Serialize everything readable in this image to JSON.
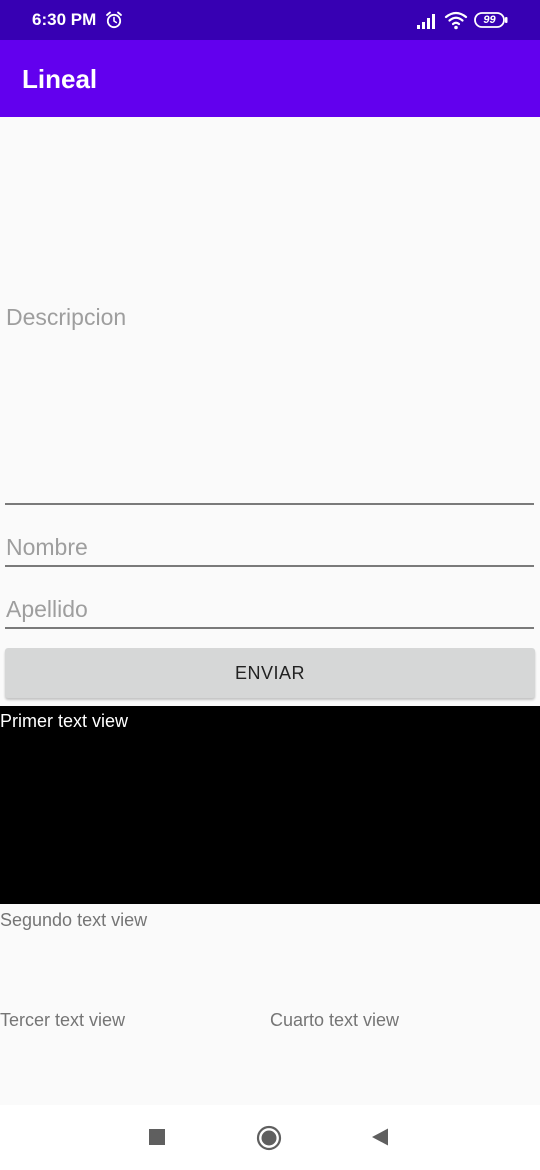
{
  "status_bar": {
    "time": "6:30 PM",
    "battery_level": "99",
    "icons": [
      "alarm-icon",
      "signal-icon",
      "wifi-icon",
      "battery-icon"
    ]
  },
  "app_bar": {
    "title": "Lineal"
  },
  "form": {
    "descripcion_hint": "Descripcion",
    "nombre_hint": "Nombre",
    "apellido_hint": "Apellido",
    "send_label": "ENVIAR"
  },
  "text_views": {
    "primero": "Primer text view",
    "segundo": "Segundo text view",
    "tercero": "Tercer text view",
    "cuarto": "Cuarto text view"
  },
  "nav_bar": {
    "icons": [
      "recent-apps-icon",
      "home-icon",
      "back-icon"
    ]
  },
  "colors": {
    "status_bar": "#3700b3",
    "app_bar": "#6200ee",
    "button": "#d6d7d7",
    "first_text_view_bg": "#000000"
  }
}
